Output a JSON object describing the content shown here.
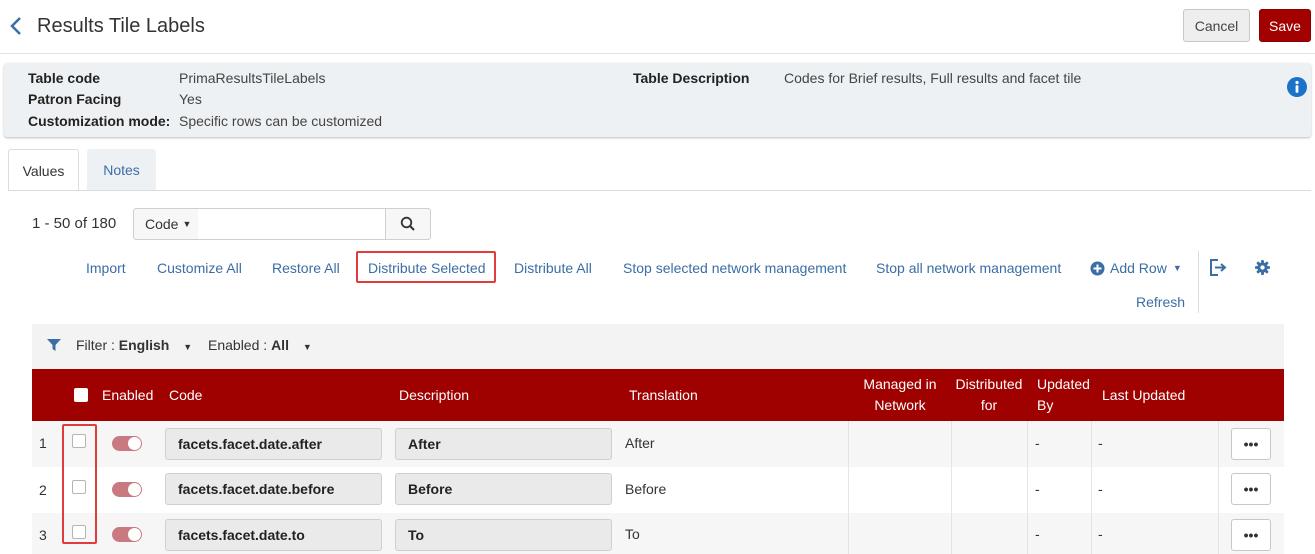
{
  "header": {
    "title": "Results Tile Labels",
    "cancel_label": "Cancel",
    "save_label": "Save",
    "save_color": "#a30000"
  },
  "info": {
    "table_code_label": "Table code",
    "table_code_value": "PrimaResultsTileLabels",
    "patron_facing_label": "Patron Facing",
    "patron_facing_value": "Yes",
    "customization_label": "Customization mode:",
    "customization_value": "Specific rows can be customized",
    "description_label": "Table Description",
    "description_value": "Codes for Brief results, Full results and facet tile",
    "info_icon": "info-circle-icon"
  },
  "tabs": [
    {
      "label": "Values",
      "active": true
    },
    {
      "label": "Notes",
      "active": false
    }
  ],
  "toolbar": {
    "count": "1 - 50 of 180",
    "search_field": "Code",
    "search_value": "",
    "actions": {
      "import": "Import",
      "customize_all": "Customize All",
      "restore_all": "Restore All",
      "distribute_selected": "Distribute Selected",
      "distribute_all": "Distribute All",
      "stop_selected": "Stop selected network management",
      "stop_all": "Stop all network management",
      "add_row": "Add Row",
      "refresh": "Refresh"
    }
  },
  "filters": {
    "filter_label": "Filter :",
    "filter_value": "English",
    "enabled_label": "Enabled :",
    "enabled_value": "All"
  },
  "table": {
    "header_color": "#9f0000",
    "columns": {
      "enabled": "Enabled",
      "code": "Code",
      "description": "Description",
      "translation": "Translation",
      "managed_line1": "Managed in",
      "managed_line2": "Network",
      "distributed_line1": "Distributed",
      "distributed_line2": "for",
      "updated_line1": "Updated",
      "updated_line2": "By",
      "last_updated": "Last Updated"
    },
    "rows": [
      {
        "num": "1",
        "code": "facets.facet.date.after",
        "description": "After",
        "translation": "After",
        "managed": "",
        "distributed": "",
        "updated_by": "-",
        "last_updated": "-",
        "enabled": true
      },
      {
        "num": "2",
        "code": "facets.facet.date.before",
        "description": "Before",
        "translation": "Before",
        "managed": "",
        "distributed": "",
        "updated_by": "-",
        "last_updated": "-",
        "enabled": true
      },
      {
        "num": "3",
        "code": "facets.facet.date.to",
        "description": "To",
        "translation": "To",
        "managed": "",
        "distributed": "",
        "updated_by": "-",
        "last_updated": "-",
        "enabled": true
      }
    ],
    "row_menu_label": "•••"
  }
}
